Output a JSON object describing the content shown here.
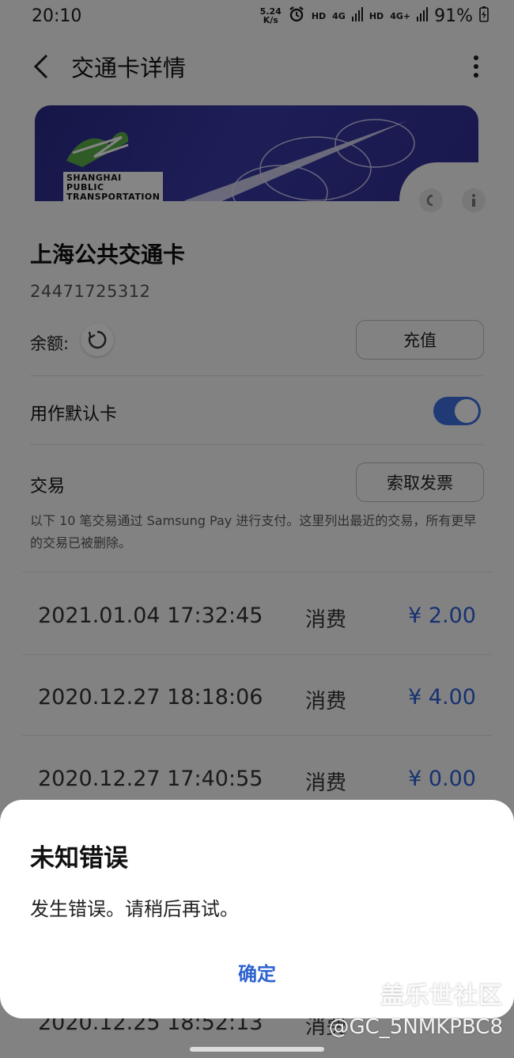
{
  "status_bar": {
    "time": "20:10",
    "net_speed_value": "5.24",
    "net_speed_unit": "K/s",
    "hd1": "HD",
    "net1": "4G",
    "hd2": "HD",
    "net2": "4G+",
    "battery": "91%"
  },
  "header": {
    "title": "交通卡详情"
  },
  "card_image": {
    "brand_line1": "SHANGHAI",
    "brand_line2": "PUBLIC",
    "brand_line3": "TRANSPORTATION"
  },
  "card": {
    "name": "上海公共交通卡",
    "number": "24471725312",
    "balance_label": "余额:",
    "recharge_label": "充值",
    "default_card_label": "用作默认卡",
    "default_card_enabled": true
  },
  "transactions": {
    "title": "交易",
    "invoice_label": "索取发票",
    "note": "以下 10 笔交易通过 Samsung Pay 进行支付。这里列出最近的交易，所有更早的交易已被删除。",
    "rows": [
      {
        "date": "2021.01.04 17:32:45",
        "type": "消费",
        "amount": "¥ 2.00"
      },
      {
        "date": "2020.12.27 18:18:06",
        "type": "消费",
        "amount": "¥ 4.00"
      },
      {
        "date": "2020.12.27 17:40:55",
        "type": "消费",
        "amount": "¥ 0.00"
      },
      {
        "date": "2020.12.25 18:52:13",
        "type": "消费",
        "amount": ""
      }
    ]
  },
  "dialog": {
    "title": "未知错误",
    "message": "发生错误。请稍后再试。",
    "ok_label": "确定"
  },
  "watermark": {
    "site": "盖乐世社区",
    "user": "@GC_5NMKPBC8"
  },
  "colors": {
    "accent": "#2e62d0",
    "toggle_on": "#3e6fe0"
  }
}
